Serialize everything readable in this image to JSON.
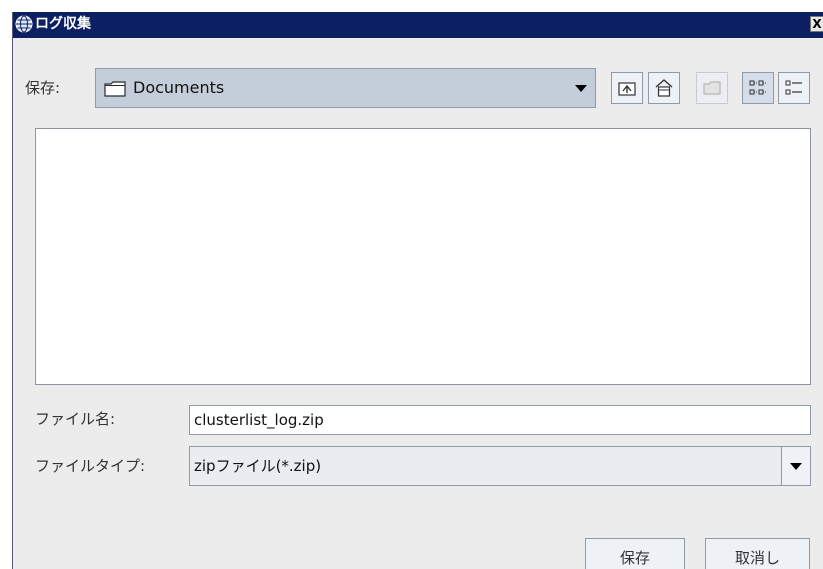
{
  "window": {
    "title": "ログ収集",
    "close_label": "X",
    "title_icon": "globe-icon"
  },
  "look_in": {
    "label": "保存:",
    "value": "Documents",
    "icon": "folder-icon"
  },
  "toolbar": {
    "buttons": [
      {
        "icon": "up-folder-icon",
        "enabled": true
      },
      {
        "icon": "home-icon",
        "enabled": true
      },
      {
        "icon": "new-folder-icon",
        "enabled": false
      },
      {
        "icon": "list-view-icon",
        "enabled": true
      },
      {
        "icon": "details-view-icon",
        "enabled": true
      }
    ]
  },
  "file_name": {
    "label": "ファイル名:",
    "value": "clusterlist_log.zip"
  },
  "file_type": {
    "label": "ファイルタイプ:",
    "value": "zipファイル(*.zip)"
  },
  "buttons": {
    "save_label": "保存",
    "cancel_label": "取消し"
  },
  "colors": {
    "titlebar": "#0c1f63",
    "combo_bg": "#c4ceda",
    "border": "#8f9bab"
  }
}
